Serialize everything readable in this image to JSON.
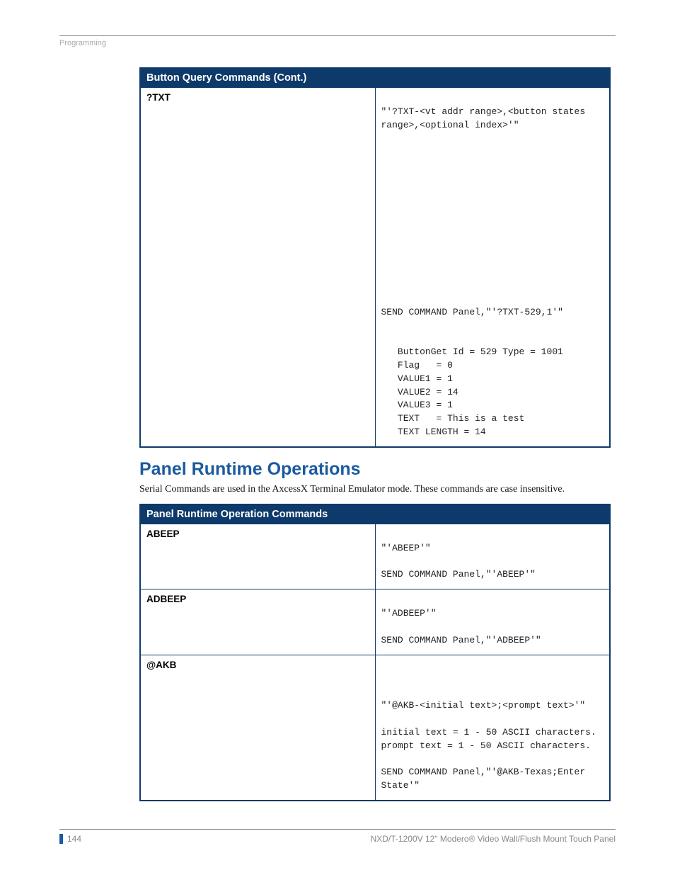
{
  "header": {
    "section_tag": "Programming"
  },
  "table1": {
    "title": "Button Query Commands (Cont.)",
    "rows": [
      {
        "name": "?TXT",
        "body": "\n\"'?TXT-<vt addr range>,<button states range>,<optional index>'\"\n\n\n\n\n\n\n\n\n\n\n\n\n\nSEND COMMAND Panel,\"'?TXT-529,1'\"\n\n\n   ButtonGet Id = 529 Type = 1001\n   Flag   = 0\n   VALUE1 = 1\n   VALUE2 = 14\n   VALUE3 = 1\n   TEXT   = This is a test\n   TEXT LENGTH = 14"
      }
    ]
  },
  "section2": {
    "heading": "Panel Runtime Operations",
    "desc": "Serial Commands are used in the AxcessX Terminal Emulator mode. These commands are case insensitive."
  },
  "table2": {
    "title": "Panel Runtime Operation Commands",
    "rows": [
      {
        "name": "ABEEP",
        "body": "\n\"'ABEEP'\"\n\nSEND COMMAND Panel,\"'ABEEP'\"\n"
      },
      {
        "name": "ADBEEP",
        "body": "\n\"'ADBEEP'\"\n\nSEND COMMAND Panel,\"'ADBEEP'\"\n"
      },
      {
        "name": "@AKB",
        "body": "\n\n\n\"'@AKB-<initial text>;<prompt text>'\"\n\ninitial text = 1 - 50 ASCII characters.\nprompt text = 1 - 50 ASCII characters.\n\nSEND COMMAND Panel,\"'@AKB-Texas;Enter State'\"\n"
      }
    ]
  },
  "footer": {
    "page_number": "144",
    "doc_title": "NXD/T-1200V 12\" Modero® Video Wall/Flush Mount Touch Panel"
  }
}
